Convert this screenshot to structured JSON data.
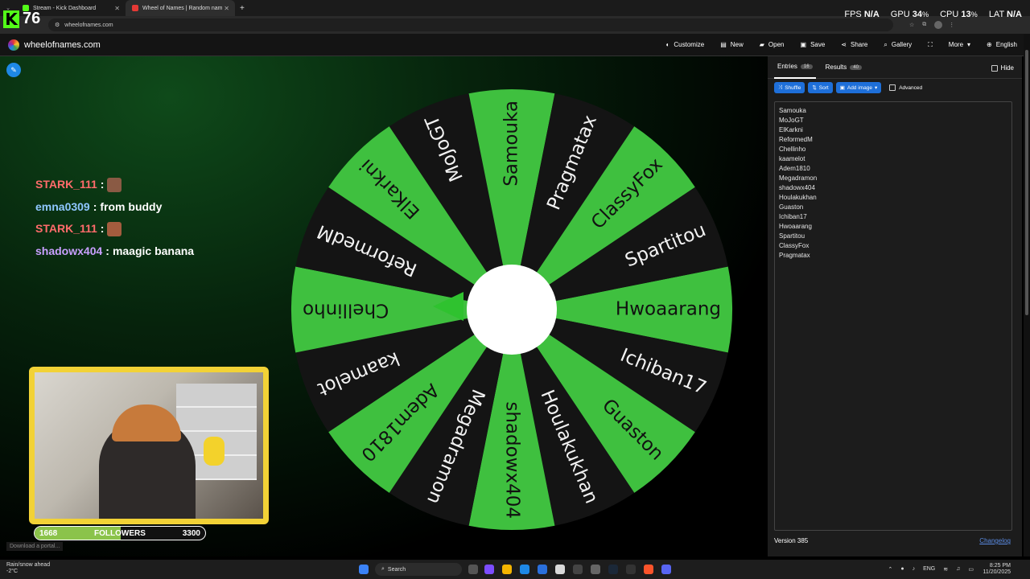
{
  "browser": {
    "tabs": [
      {
        "title": "Stream - Kick Dashboard",
        "favicon_color": "#53fc18",
        "active": false
      },
      {
        "title": "Wheel of Names | Random nam",
        "favicon_color": "#e53935",
        "active": true
      }
    ],
    "new_tab": "+",
    "address": "wheelofnames.com"
  },
  "overlay": {
    "kick_logo": "K",
    "viewer_count": "76",
    "perf": [
      {
        "label": "FPS",
        "value": "N/A"
      },
      {
        "label": "GPU",
        "value": "34",
        "unit": "%"
      },
      {
        "label": "CPU",
        "value": "13",
        "unit": "%"
      },
      {
        "label": "LAT",
        "value": "N/A"
      }
    ]
  },
  "app": {
    "site_name": "wheelofnames.com",
    "menu": [
      {
        "label": "Customize",
        "icon": "palette-icon",
        "glyph": "◐"
      },
      {
        "label": "New",
        "icon": "file-icon",
        "glyph": "▤"
      },
      {
        "label": "Open",
        "icon": "folder-icon",
        "glyph": "▰"
      },
      {
        "label": "Save",
        "icon": "save-icon",
        "glyph": "▣"
      },
      {
        "label": "Share",
        "icon": "share-icon",
        "glyph": "⋖"
      },
      {
        "label": "Gallery",
        "icon": "search-icon",
        "glyph": "⌕"
      },
      {
        "label": "",
        "icon": "fullscreen-icon",
        "glyph": "⛶"
      },
      {
        "label": "More",
        "icon": "chevron-down-icon",
        "glyph": "▾"
      },
      {
        "label": "English",
        "icon": "globe-icon",
        "glyph": "⊕"
      }
    ]
  },
  "chat": [
    {
      "user": "STARK_111",
      "msg": "",
      "color": "#ff6b6b",
      "emote": true
    },
    {
      "user": "emna0309",
      "msg": "from buddy",
      "color": "#8fc7ff",
      "emote": false
    },
    {
      "user": "STARK_111",
      "msg": "",
      "color": "#ff6b6b",
      "emote": true
    },
    {
      "user": "shadowx404",
      "msg": "maagic banana",
      "color": "#c9a0ff",
      "emote": false
    }
  ],
  "followers": {
    "label": "FOLLOWERS",
    "current": "1668",
    "goal": "3300",
    "progress": 0.505
  },
  "wheel": {
    "colors": {
      "green": "#3fc03f",
      "dark": "#141414"
    },
    "segments": [
      "Hwoaarang",
      "Ichiban17",
      "Guaston",
      "Houlakukhan",
      "shadowx404",
      "Megadramon",
      "Adem1810",
      "kaamelot",
      "Chellinho",
      "ReformedM",
      "ElKarkni",
      "MoJoGT",
      "Samouka",
      "Pragmatax",
      "ClassyFox",
      "Spartitou"
    ]
  },
  "panel": {
    "tabs": [
      {
        "label": "Entries",
        "count": "16"
      },
      {
        "label": "Results",
        "count": "40"
      }
    ],
    "hide_label": "Hide",
    "buttons": {
      "shuffle": "Shuffle",
      "sort": "Sort",
      "add_image": "Add image",
      "advanced": "Advanced"
    },
    "entries": [
      "Samouka",
      "MoJoGT",
      "ElKarkni",
      "ReformedM",
      "Chellinho",
      "kaamelot",
      "Adem1810",
      "Megadramon",
      "shadowx404",
      "Houlakukhan",
      "Guaston",
      "Ichiban17",
      "Hwoaarang",
      "Spartitou",
      "ClassyFox",
      "Pragmatax"
    ],
    "version": "Version 385",
    "changelog": "Changelog"
  },
  "bottom_tip": "Download a portal...",
  "taskbar": {
    "weather_title": "Rain/snow ahead",
    "weather_temp": "-2°C",
    "search_placeholder": "Search",
    "lang": "ENG",
    "time": "8:25 PM",
    "date": "11/20/2025"
  }
}
